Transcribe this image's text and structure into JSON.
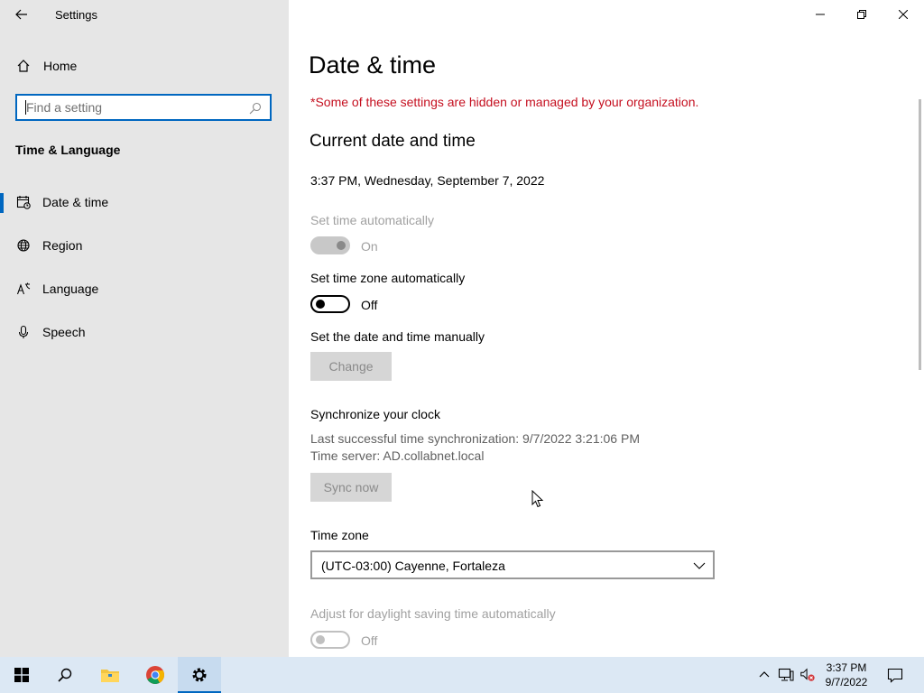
{
  "window": {
    "title": "Settings",
    "controls": {
      "minimize": "minimize-icon",
      "restore": "restore-icon",
      "close": "close-icon"
    }
  },
  "sidebar": {
    "home_label": "Home",
    "search": {
      "placeholder": "Find a setting",
      "value": ""
    },
    "section_title": "Time & Language",
    "items": [
      {
        "label": "Date & time",
        "icon": "calendar-clock-icon",
        "active": true
      },
      {
        "label": "Region",
        "icon": "globe-icon",
        "active": false
      },
      {
        "label": "Language",
        "icon": "language-icon",
        "active": false
      },
      {
        "label": "Speech",
        "icon": "microphone-icon",
        "active": false
      }
    ]
  },
  "main": {
    "page_title": "Date & time",
    "org_notice": "*Some of these settings are hidden or managed by your organization.",
    "current_heading": "Current date and time",
    "current_value": "3:37 PM, Wednesday, September 7, 2022",
    "set_time_auto": {
      "label": "Set time automatically",
      "state": "On",
      "enabled": false,
      "on": true
    },
    "set_timezone_auto": {
      "label": "Set time zone automatically",
      "state": "Off",
      "enabled": true,
      "on": false
    },
    "manual": {
      "label": "Set the date and time manually",
      "button": "Change"
    },
    "sync": {
      "heading": "Synchronize your clock",
      "last_sync": "Last successful time synchronization: 9/7/2022 3:21:06 PM",
      "server": "Time server: AD.collabnet.local",
      "button": "Sync now"
    },
    "timezone": {
      "label": "Time zone",
      "value": "(UTC-03:00) Cayenne, Fortaleza"
    },
    "dst": {
      "label": "Adjust for daylight saving time automatically",
      "state": "Off",
      "enabled": false,
      "on": false
    }
  },
  "taskbar": {
    "items": [
      "start-icon",
      "search-icon",
      "file-explorer-icon",
      "chrome-icon",
      "settings-icon"
    ],
    "active_item": "settings-icon",
    "tray": [
      "chevron-up-icon",
      "network-icon",
      "volume-muted-icon"
    ],
    "clock": {
      "time": "3:37 PM",
      "date": "9/7/2022"
    },
    "notifications_icon": "action-center-icon"
  },
  "colors": {
    "accent": "#0067c0",
    "warning": "#c50f1f",
    "sidebar_bg": "#e6e6e6",
    "taskbar_bg": "#dce8f4"
  }
}
